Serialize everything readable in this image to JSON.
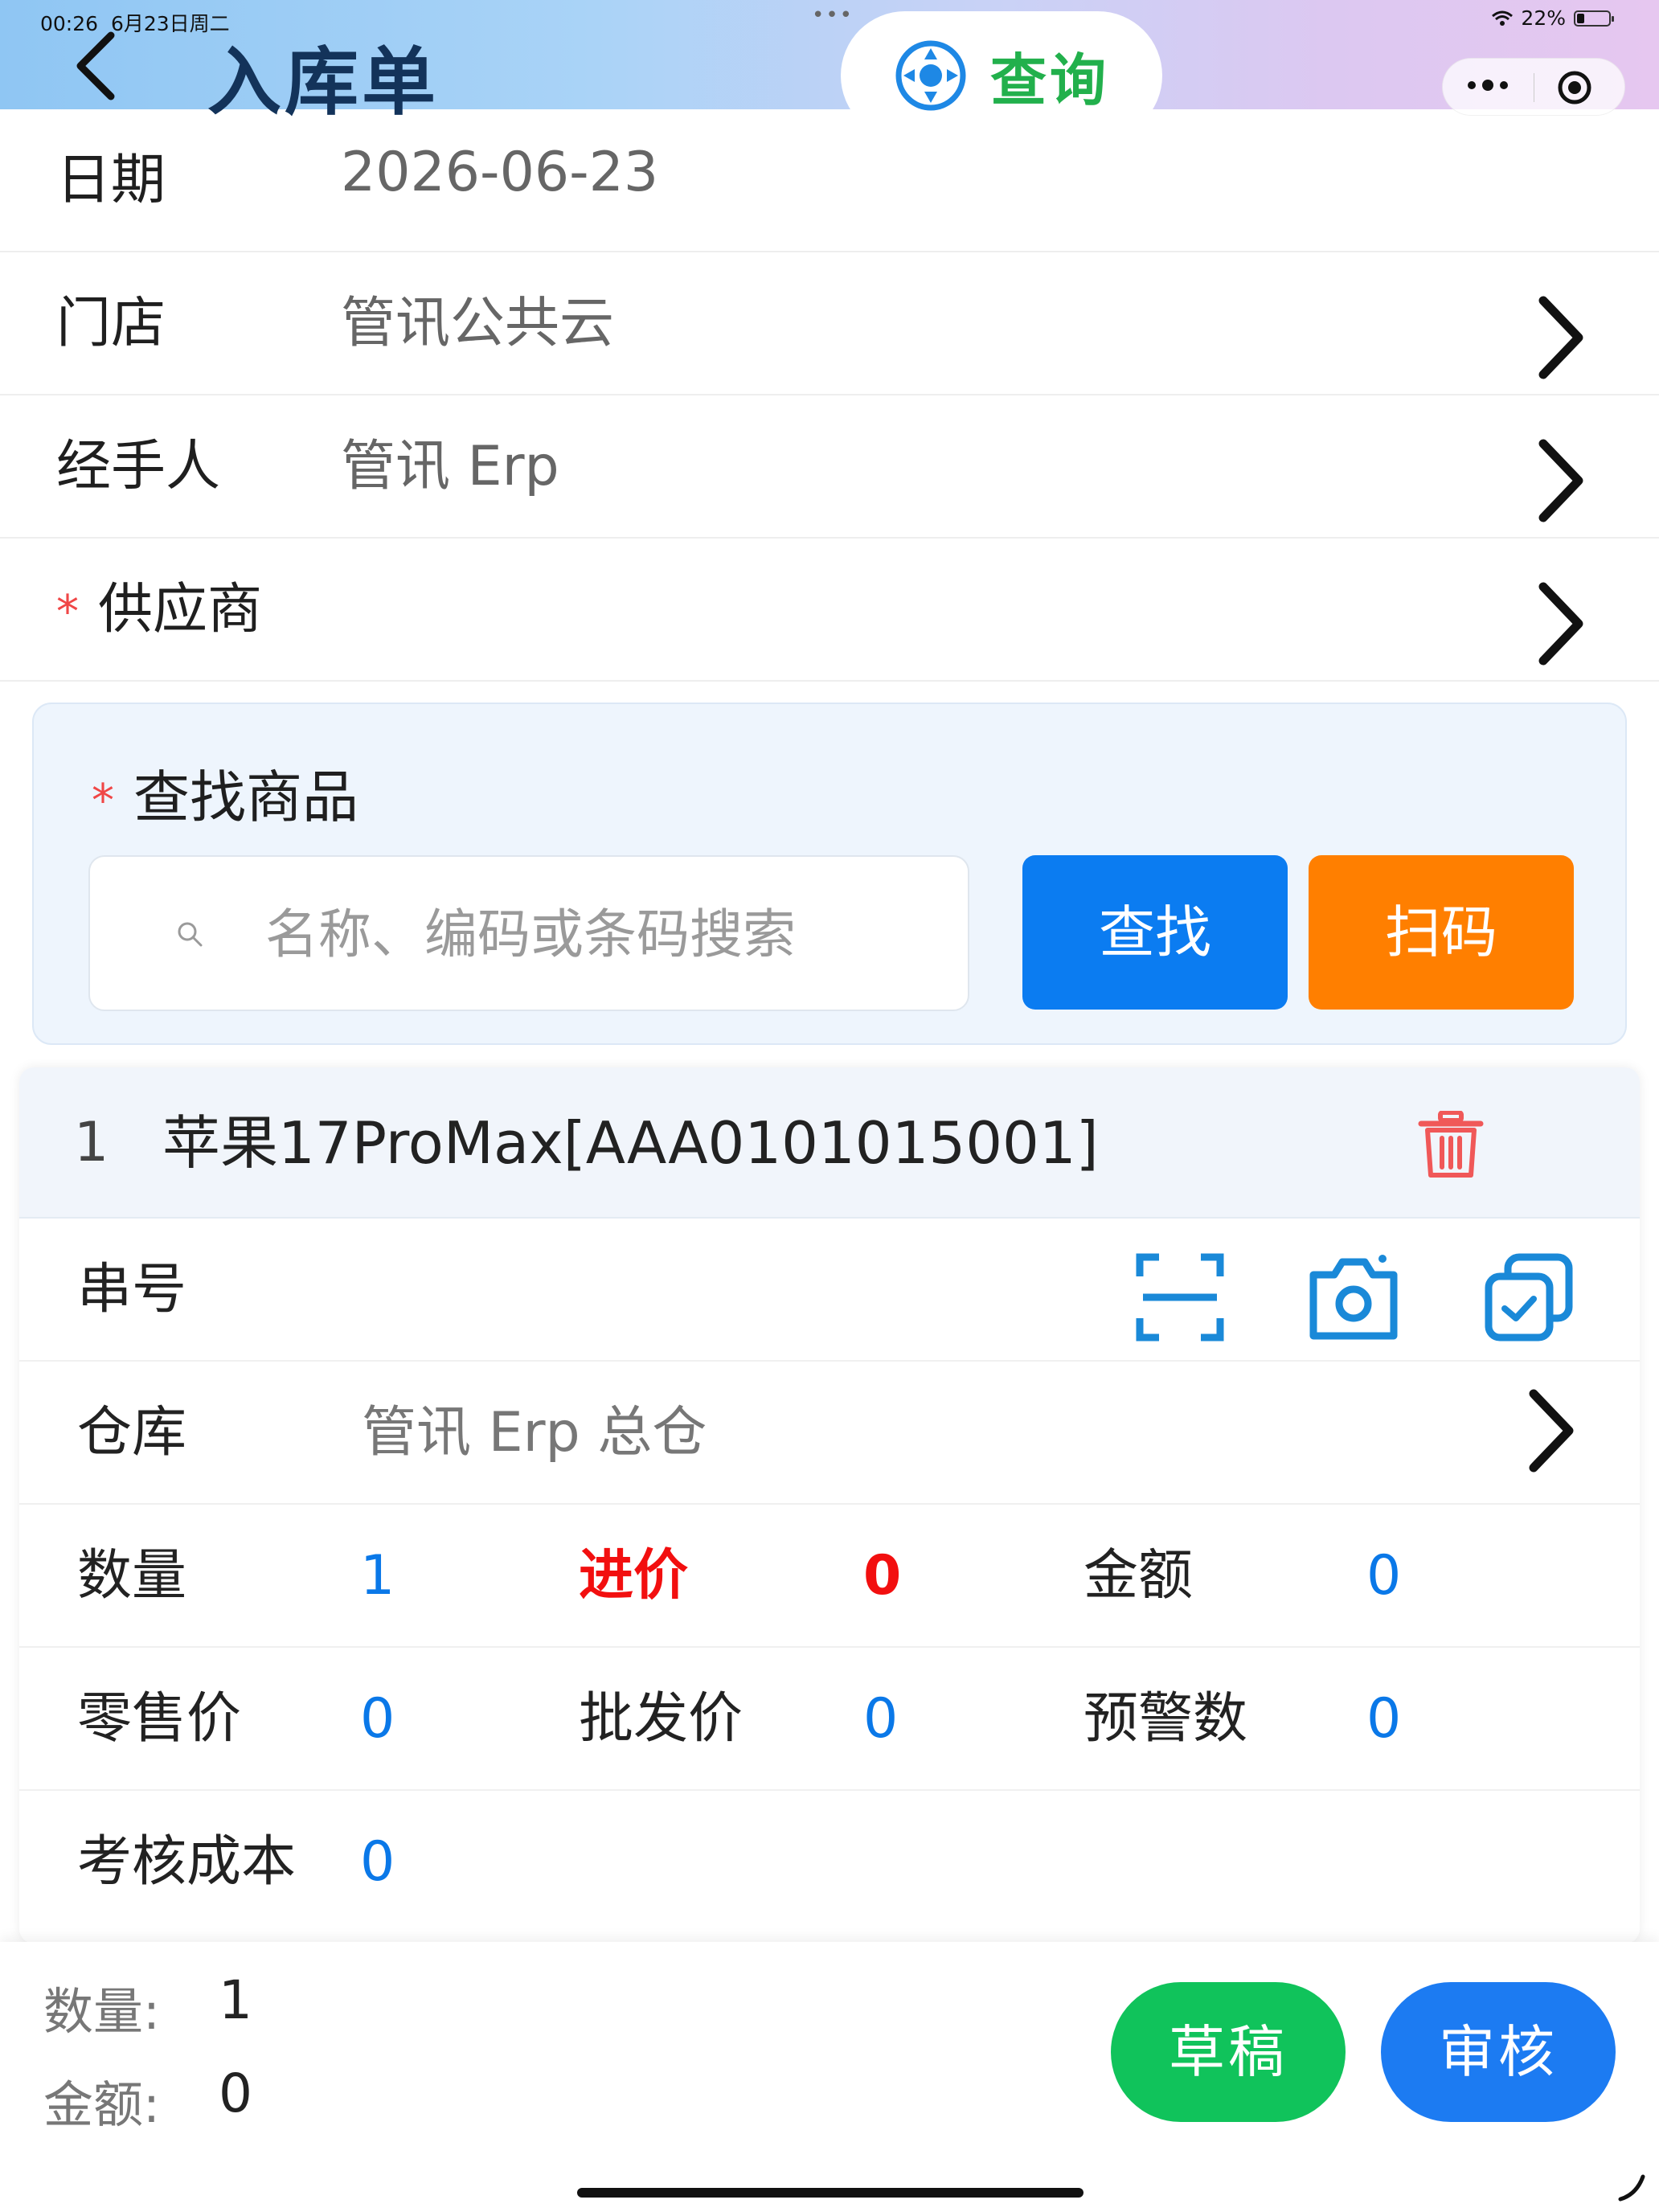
{
  "status_bar": {
    "time": "00:26",
    "date": "6月23日周二",
    "battery": "22%"
  },
  "nav": {
    "title": "入库单",
    "query_label": "查询"
  },
  "form": {
    "date": {
      "label": "日期",
      "value": "2026-06-23"
    },
    "store": {
      "label": "门店",
      "value": "管讯公共云"
    },
    "handler": {
      "label": "经手人",
      "value": "管讯 Erp"
    },
    "supplier": {
      "required_mark": "*",
      "label": "供应商",
      "value": ""
    }
  },
  "search": {
    "required_mark": "*",
    "title": "查找商品",
    "placeholder": "名称、编码或条码搜索",
    "find_label": "查找",
    "scan_label": "扫码"
  },
  "item": {
    "index": "1",
    "name": "苹果17ProMax[AAA0101015001]",
    "serial_label": "串号",
    "warehouse_label": "仓库",
    "warehouse_value": "管讯 Erp 总仓",
    "qty_label": "数量",
    "qty_value": "1",
    "cost_label": "进价",
    "cost_value": "0",
    "amount_label": "金额",
    "amount_value": "0",
    "retail_label": "零售价",
    "retail_value": "0",
    "wholesale_label": "批发价",
    "wholesale_value": "0",
    "alert_label": "预警数",
    "alert_value": "0",
    "assess_label": "考核成本",
    "assess_value": "0"
  },
  "footer": {
    "qty_label": "数量:",
    "qty_value": "1",
    "amount_label": "金额:",
    "amount_value": "0",
    "draft_label": "草稿",
    "audit_label": "审核"
  },
  "colors": {
    "accent_blue": "#0b7cf1",
    "scan_orange": "#ff7f00",
    "draft_green": "#10c35b",
    "audit_blue": "#1c7bf2",
    "query_green": "#22b04c",
    "price_red": "#f20f0f",
    "value_blue": "#0a78e8"
  },
  "icons": [
    "back-icon",
    "navigator-icon",
    "more-icon",
    "target-icon",
    "chevron-right-icon",
    "search-icon",
    "trash-icon",
    "scan-frame-icon",
    "camera-icon",
    "copy-check-icon",
    "wifi-icon",
    "battery-icon"
  ]
}
